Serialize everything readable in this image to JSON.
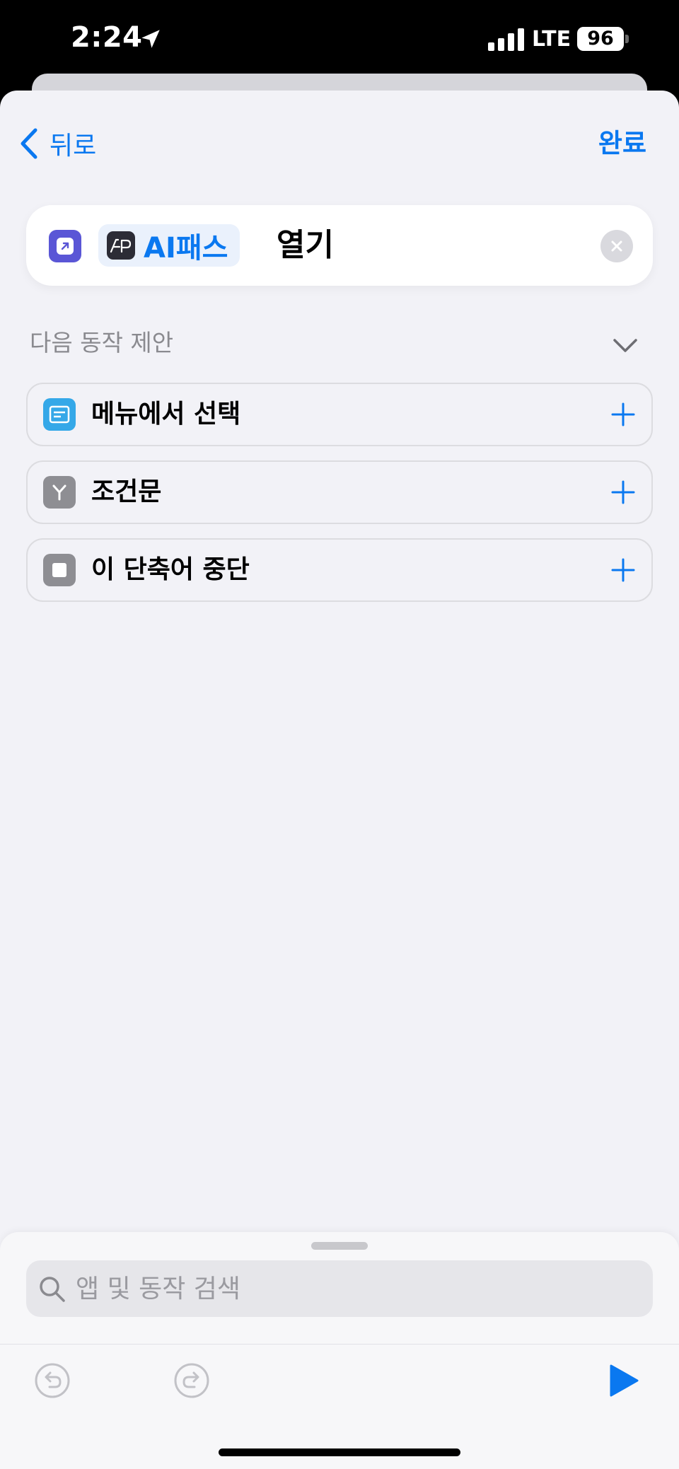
{
  "status_bar": {
    "time": "2:24",
    "network": "LTE",
    "battery": "96"
  },
  "nav": {
    "back_label": "뒤로",
    "done_label": "완료"
  },
  "action": {
    "app_name": "AI패스",
    "app_logo_text": "AiP",
    "verb": "열기"
  },
  "suggestions": {
    "header": "다음 동작 제안",
    "items": [
      {
        "label": "메뉴에서 선택",
        "icon": "menu-list-icon",
        "color": "#35a8e8"
      },
      {
        "label": "조건문",
        "icon": "branch-icon",
        "color": "#8e8e93"
      },
      {
        "label": "이 단축어 중단",
        "icon": "stop-icon",
        "color": "#8e8e93"
      }
    ]
  },
  "search": {
    "placeholder": "앱 및 동작 검색"
  },
  "colors": {
    "accent": "#0a78f0",
    "background": "#f2f2f7",
    "open_app_icon": "#5a56d6"
  }
}
